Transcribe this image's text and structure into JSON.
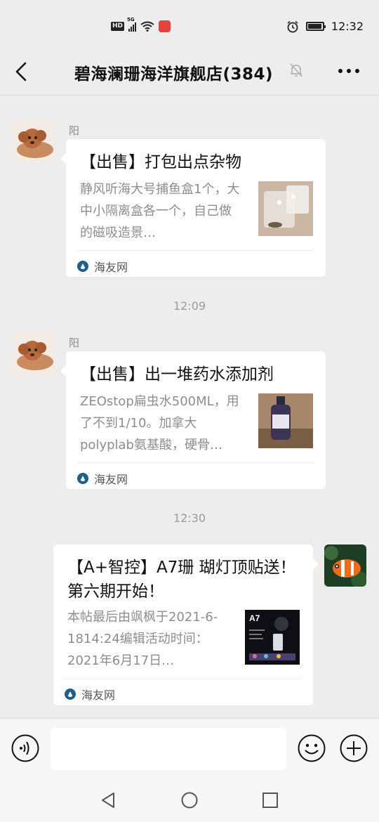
{
  "status_bar": {
    "network": "HD",
    "signal": "5G",
    "time": "12:32"
  },
  "header": {
    "title": "碧海澜珊海洋旗舰店(384)",
    "back_icon": "back-arrow-icon",
    "mute_icon": "bell-off-icon",
    "more_icon": "more-dots-icon"
  },
  "messages": [
    {
      "sender": "阳",
      "side": "left",
      "title": "【出售】打包出点杂物",
      "desc": "静风听海大号捕鱼盒1个，大中小隔离盒各一个，自己做的磁吸造景…",
      "source": "海友网"
    },
    {
      "time": "12:09",
      "sender": "阳",
      "side": "left",
      "title": "【出售】出一堆药水添加剂",
      "desc": "ZEOstop扁虫水500ML，用了不到1/10。加拿大polyplab氨基酸，硬骨…",
      "source": "海友网"
    },
    {
      "time": "12:30",
      "side": "right",
      "title": "【A+智控】A7珊 瑚灯顶贴送！第六期开始！",
      "desc": "本帖最后由飒枫于2021-6-1814:24编辑活动时间：2021年6月17日…",
      "source": "海友网",
      "thumb_label": "A7"
    }
  ],
  "input_bar": {
    "placeholder": "",
    "voice_icon": "voice-icon",
    "emoji_icon": "emoji-icon",
    "plus_icon": "plus-icon"
  },
  "colors": {
    "background": "#ededed",
    "card": "#ffffff",
    "desc_text": "#8d8d8d"
  }
}
